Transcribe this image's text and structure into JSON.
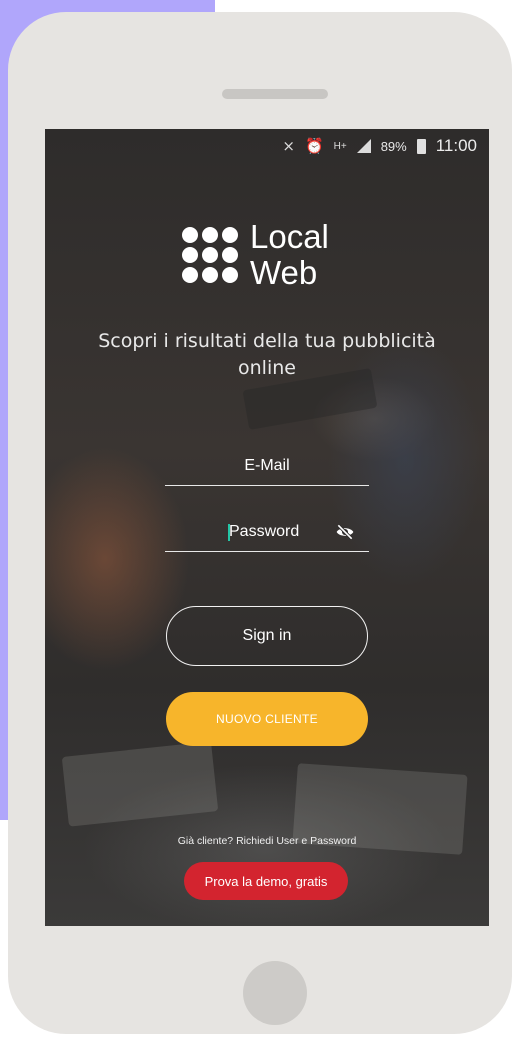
{
  "colors": {
    "background_accent": "#b0a6fb",
    "phone_body": "#e6e4e1",
    "new_client_button": "#f7b52b",
    "demo_button": "#d3242f",
    "input_caret": "#23c6a6"
  },
  "status_bar": {
    "icons": [
      "mute-icon",
      "alarm-icon",
      "h-plus-network-icon",
      "signal-icon",
      "battery-icon"
    ],
    "network": "H+",
    "battery": "89%",
    "time": "11:00"
  },
  "logo": {
    "line1": "Local",
    "line2": "Web"
  },
  "tagline": "Scopri i risultati della tua pubblicità online",
  "form": {
    "email_placeholder": "E-Mail",
    "password_placeholder": "Password",
    "password_toggle_icon": "eye-slash-icon"
  },
  "buttons": {
    "sign_in": "Sign in",
    "new_client": "NUOVO CLIENTE",
    "demo": "Prova la demo, gratis"
  },
  "footer": {
    "already_client": "Già cliente? Richiedi User e Password"
  }
}
